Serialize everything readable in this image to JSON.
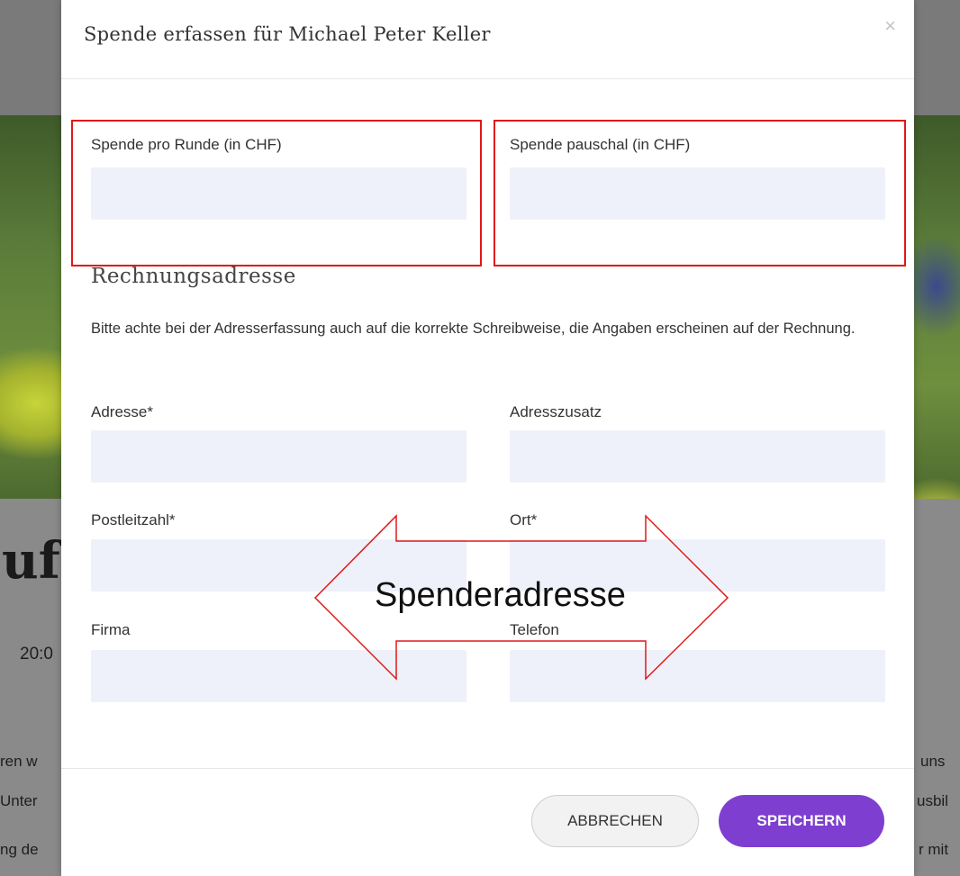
{
  "modal": {
    "title": "Spende erfassen für Michael Peter Keller",
    "close_glyph": "×"
  },
  "donation": {
    "per_round_label": "Spende pro Runde (in CHF)",
    "per_round_value": "",
    "flat_label": "Spende pauschal (in CHF)",
    "flat_value": ""
  },
  "billing": {
    "section_title": "Rechnungsadresse",
    "hint": "Bitte achte bei der Adresserfassung auch auf die korrekte Schreibweise, die Angaben erscheinen auf der Rechnung.",
    "fields": {
      "address_label": "Adresse*",
      "address_value": "",
      "address_extra_label": "Adresszusatz",
      "address_extra_value": "",
      "zip_label": "Postleitzahl*",
      "zip_value": "",
      "city_label": "Ort*",
      "city_value": "",
      "company_label": "Firma",
      "company_value": "",
      "phone_label": "Telefon",
      "phone_value": ""
    }
  },
  "footer": {
    "cancel_label": "ABBRECHEN",
    "save_label": "SPEICHERN"
  },
  "annotation": {
    "arrow_label": "Spenderadresse",
    "color": "#e01818"
  },
  "background": {
    "heading_fragment": "uf",
    "time_fragment": "20:0",
    "text_left_1": "ren w",
    "text_left_2": "Unter",
    "text_left_3": "ng de",
    "text_right_1": "uns",
    "text_right_2": "usbil",
    "text_right_3": "r mit"
  },
  "colors": {
    "accent": "#7e3fd0",
    "input_bg": "#eef1f9",
    "overlay": "#7a7a7a"
  }
}
